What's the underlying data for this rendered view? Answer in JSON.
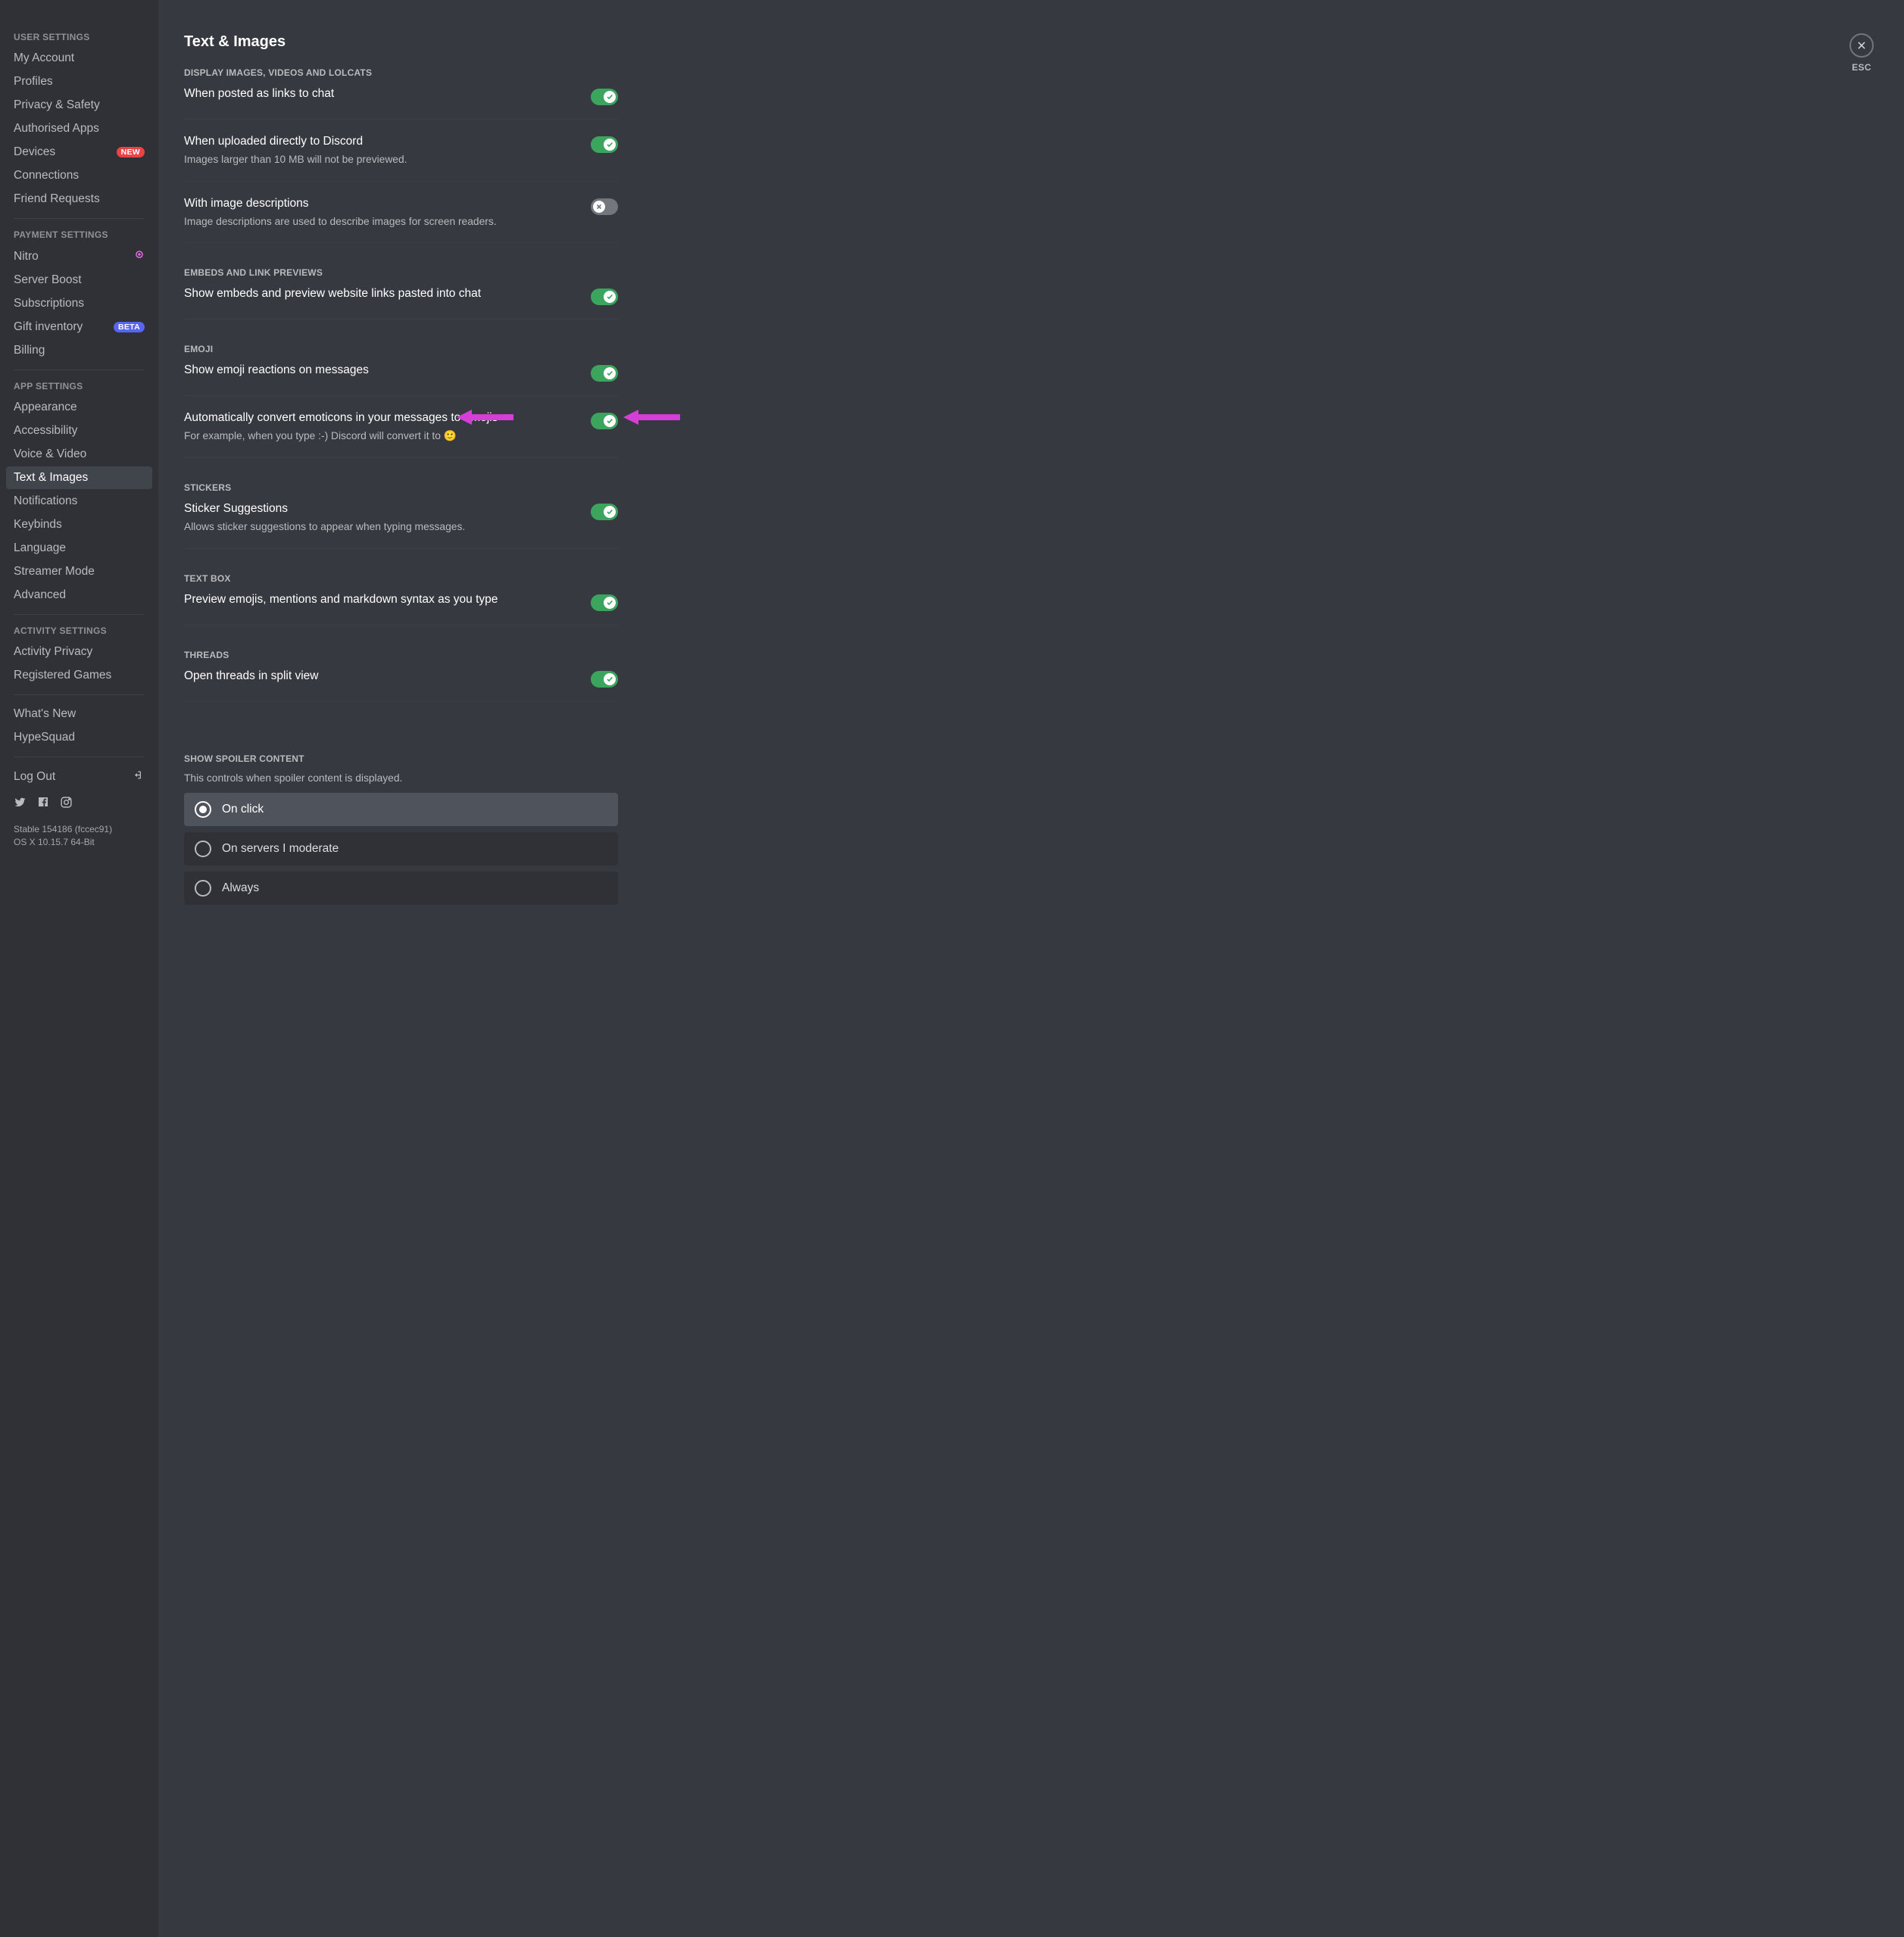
{
  "sidebar": {
    "sections": [
      {
        "header": "USER SETTINGS",
        "items": [
          {
            "label": "My Account"
          },
          {
            "label": "Profiles"
          },
          {
            "label": "Privacy & Safety"
          },
          {
            "label": "Authorised Apps"
          },
          {
            "label": "Devices",
            "badge": "NEW",
            "badge_kind": "red"
          },
          {
            "label": "Connections"
          },
          {
            "label": "Friend Requests"
          }
        ]
      },
      {
        "header": "PAYMENT SETTINGS",
        "items": [
          {
            "label": "Nitro",
            "icon": "nitro"
          },
          {
            "label": "Server Boost"
          },
          {
            "label": "Subscriptions"
          },
          {
            "label": "Gift inventory",
            "badge": "BETA",
            "badge_kind": "blue"
          },
          {
            "label": "Billing"
          }
        ]
      },
      {
        "header": "APP SETTINGS",
        "items": [
          {
            "label": "Appearance"
          },
          {
            "label": "Accessibility"
          },
          {
            "label": "Voice & Video"
          },
          {
            "label": "Text & Images",
            "selected": true
          },
          {
            "label": "Notifications"
          },
          {
            "label": "Keybinds"
          },
          {
            "label": "Language"
          },
          {
            "label": "Streamer Mode"
          },
          {
            "label": "Advanced"
          }
        ]
      },
      {
        "header": "ACTIVITY SETTINGS",
        "items": [
          {
            "label": "Activity Privacy"
          },
          {
            "label": "Registered Games"
          }
        ]
      },
      {
        "items": [
          {
            "label": "What's New"
          },
          {
            "label": "HypeSquad"
          }
        ]
      },
      {
        "items": [
          {
            "label": "Log Out",
            "icon": "logout"
          }
        ]
      }
    ],
    "version_line1": "Stable 154186 (fccec91)",
    "version_line2": "OS X 10.15.7 64-Bit"
  },
  "page": {
    "title": "Text & Images",
    "close_kb": "ESC",
    "groups": [
      {
        "header": "DISPLAY IMAGES, VIDEOS AND LOLCATS",
        "rows": [
          {
            "title": "When posted as links to chat",
            "on": true
          },
          {
            "title": "When uploaded directly to Discord",
            "desc": "Images larger than 10 MB will not be previewed.",
            "on": true
          },
          {
            "title": "With image descriptions",
            "desc": "Image descriptions are used to describe images for screen readers.",
            "on": false
          }
        ]
      },
      {
        "header": "EMBEDS AND LINK PREVIEWS",
        "rows": [
          {
            "title": "Show embeds and preview website links pasted into chat",
            "on": true
          }
        ]
      },
      {
        "header": "EMOJI",
        "rows": [
          {
            "title": "Show emoji reactions on messages",
            "on": true
          },
          {
            "title": "Automatically convert emoticons in your messages to emojis",
            "desc": "For example, when you type :-) Discord will convert it to 🙂",
            "on": true,
            "arrows": true
          }
        ]
      },
      {
        "header": "STICKERS",
        "rows": [
          {
            "title": "Sticker Suggestions",
            "desc": "Allows sticker suggestions to appear when typing messages.",
            "on": true
          }
        ]
      },
      {
        "header": "TEXT BOX",
        "rows": [
          {
            "title": "Preview emojis, mentions and markdown syntax as you type",
            "on": true
          }
        ]
      },
      {
        "header": "THREADS",
        "rows": [
          {
            "title": "Open threads in split view",
            "on": true
          }
        ]
      }
    ],
    "spoiler": {
      "header": "SHOW SPOILER CONTENT",
      "desc": "This controls when spoiler content is displayed.",
      "options": [
        {
          "label": "On click",
          "selected": true
        },
        {
          "label": "On servers I moderate",
          "selected": false
        },
        {
          "label": "Always",
          "selected": false
        }
      ]
    }
  }
}
